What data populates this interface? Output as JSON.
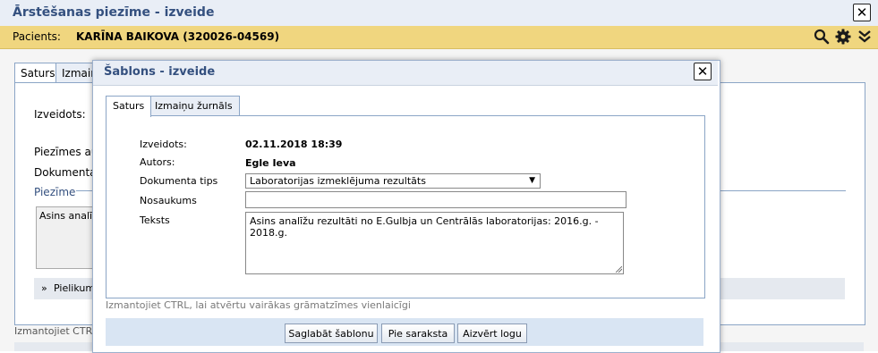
{
  "outer": {
    "title": "Ārstēšanas piezīme - izveide",
    "patient_label": "Pacients:",
    "patient_value": "KARĪNA BAIKOVA (320026-04569)",
    "icons": [
      "search-icon",
      "gear-icon",
      "double-chevron-down-icon"
    ],
    "tabs": [
      "Saturs",
      "Izmaiņ"
    ],
    "fields": [
      "Izveidots:",
      "Piezīmes auto",
      "Dokumenta ti"
    ],
    "section_label": "Piezīme",
    "textarea_snippet": "Asins analīz",
    "pielikumi": "Pielikumi",
    "hint": "Izmantojiet CTRL,"
  },
  "dialog": {
    "title": "Šablons - izveide",
    "tabs": [
      {
        "label": "Saturs",
        "active": true
      },
      {
        "label": "Izmaiņu žurnāls",
        "active": false
      }
    ],
    "fields": {
      "created_label": "Izveidots:",
      "created_value": "02.11.2018 18:39",
      "author_label": "Autors:",
      "author_value": "Egle Ieva",
      "doc_type_label": "Dokumenta tips",
      "doc_type_value": "Laboratorijas izmeklējuma rezultāts",
      "name_label": "Nosaukums",
      "name_value": "",
      "text_label": "Teksts",
      "text_value": "Asins analīžu rezultāti no E.Gulbja un Centrālās laboratorijas: 2016.g. - 2018.g."
    },
    "hint": "Izmantojiet CTRL, lai atvērtu vairākas grāmatzīmes vienlaicīgi",
    "buttons": {
      "save": "Saglabāt šablonu",
      "list": "Pie saraksta",
      "close": "Aizvērt logu"
    }
  },
  "colors": {
    "title_text": "#34507f",
    "patient_bar": "#f0d67f",
    "panel_border": "#8ba5c6",
    "button_bar": "#d9e5f3"
  }
}
